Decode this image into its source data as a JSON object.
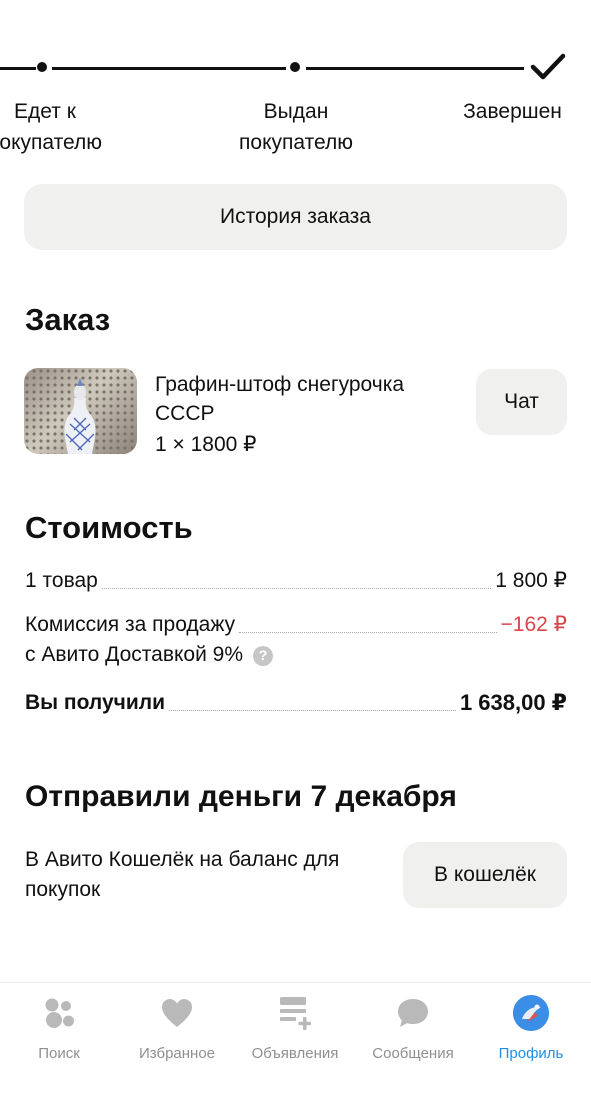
{
  "progress": {
    "steps": [
      {
        "label_line1": "Едет к",
        "label_line2": "покупателю"
      },
      {
        "label_line1": "Выдан",
        "label_line2": "покупателю"
      },
      {
        "label_line1": "Завершен",
        "label_line2": ""
      }
    ],
    "completed_icon": "checkmark-icon"
  },
  "history_button": "История заказа",
  "order": {
    "title": "Заказ",
    "product_name": "Графин-штоф снегурочка СССР",
    "quantity_price": "1 × 1800 ₽",
    "chat_button": "Чат"
  },
  "cost": {
    "title": "Стоимость",
    "items_label": "1 товар",
    "items_value": "1 800 ₽",
    "fee_label_line1": "Комиссия за продажу",
    "fee_label_line2": "с Авито Доставкой 9%",
    "fee_value": "−162 ₽",
    "fee_help_icon": "question-icon",
    "total_label": "Вы получили",
    "total_value": "1 638,00 ₽",
    "fee_color": "#d8454a"
  },
  "payout": {
    "title": "Отправили деньги 7 декабря",
    "description": "В Авито Кошелёк на баланс для покупок",
    "wallet_button": "В кошелёк"
  },
  "tabbar": {
    "active_color": "#1f8fe5",
    "tabs": [
      {
        "label": "Поиск",
        "icon": "search-bubbles-icon"
      },
      {
        "label": "Избранное",
        "icon": "heart-icon"
      },
      {
        "label": "Объявления",
        "icon": "list-add-icon"
      },
      {
        "label": "Сообщения",
        "icon": "chat-bubble-icon"
      },
      {
        "label": "Профиль",
        "icon": "avatar-icon",
        "active": true
      }
    ]
  }
}
